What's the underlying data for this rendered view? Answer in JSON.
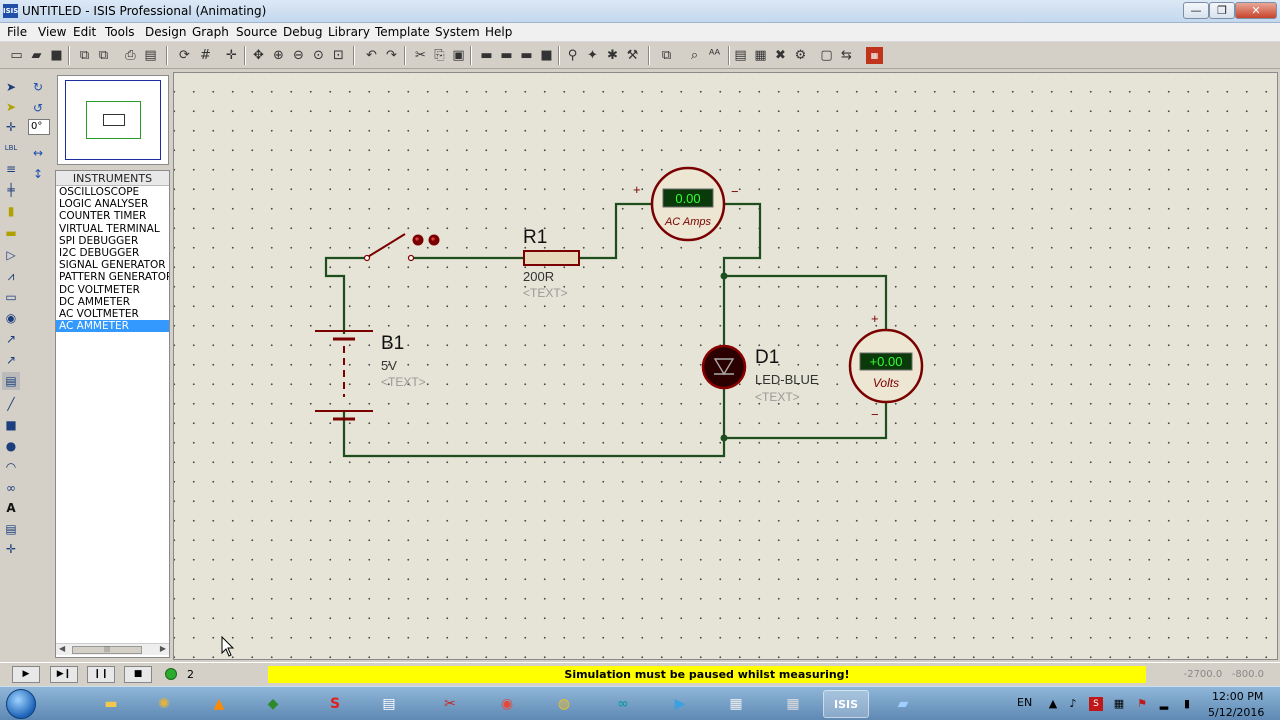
{
  "window": {
    "title": "UNTITLED - ISIS Professional (Animating)",
    "app_icon_label": "ISIS",
    "minimize": "—",
    "maximize": "❐",
    "close": "✕"
  },
  "menu": [
    "File",
    "View",
    "Edit",
    "Tools",
    "Design",
    "Graph",
    "Source",
    "Debug",
    "Library",
    "Template",
    "System",
    "Help"
  ],
  "side_tools": {
    "rotation_value": "0°"
  },
  "instruments": {
    "header": "INSTRUMENTS",
    "items": [
      "OSCILLOSCOPE",
      "LOGIC ANALYSER",
      "COUNTER TIMER",
      "VIRTUAL TERMINAL",
      "SPI DEBUGGER",
      "I2C DEBUGGER",
      "SIGNAL GENERATOR",
      "PATTERN GENERATOR",
      "DC VOLTMETER",
      "DC AMMETER",
      "AC VOLTMETER",
      "AC AMMETER"
    ],
    "selected_index": 11,
    "scroll_thumb": "|||"
  },
  "schematic": {
    "switch": {},
    "resistor": {
      "ref": "R1",
      "value": "200R",
      "text": "<TEXT>"
    },
    "battery": {
      "ref": "B1",
      "value": "5V",
      "text": "<TEXT>"
    },
    "led": {
      "ref": "D1",
      "value": "LED-BLUE",
      "text": "<TEXT>"
    },
    "ammeter": {
      "display": "0.00",
      "label": "AC Amps",
      "plus": "+",
      "minus": "−"
    },
    "voltmeter": {
      "display": "+0.00",
      "label": "Volts",
      "plus": "+",
      "minus": "−"
    },
    "colors": {
      "wire": "#1e4e1e",
      "component": "#7a0000",
      "meter_bg": "#ece6d2",
      "display_bg": "#0a3a0a",
      "display_text": "#32ff32"
    }
  },
  "status": {
    "sim_buttons": [
      "▶",
      "▶❙",
      "❙❙",
      "■"
    ],
    "messages": "2 Message(s)",
    "message_text": "Simulation must be paused whilst measuring!",
    "coords_x": "-2700.0",
    "coords_y": "-800.0"
  },
  "taskbar": {
    "language": "EN",
    "time": "12:00 PM",
    "date": "5/12/2016"
  }
}
